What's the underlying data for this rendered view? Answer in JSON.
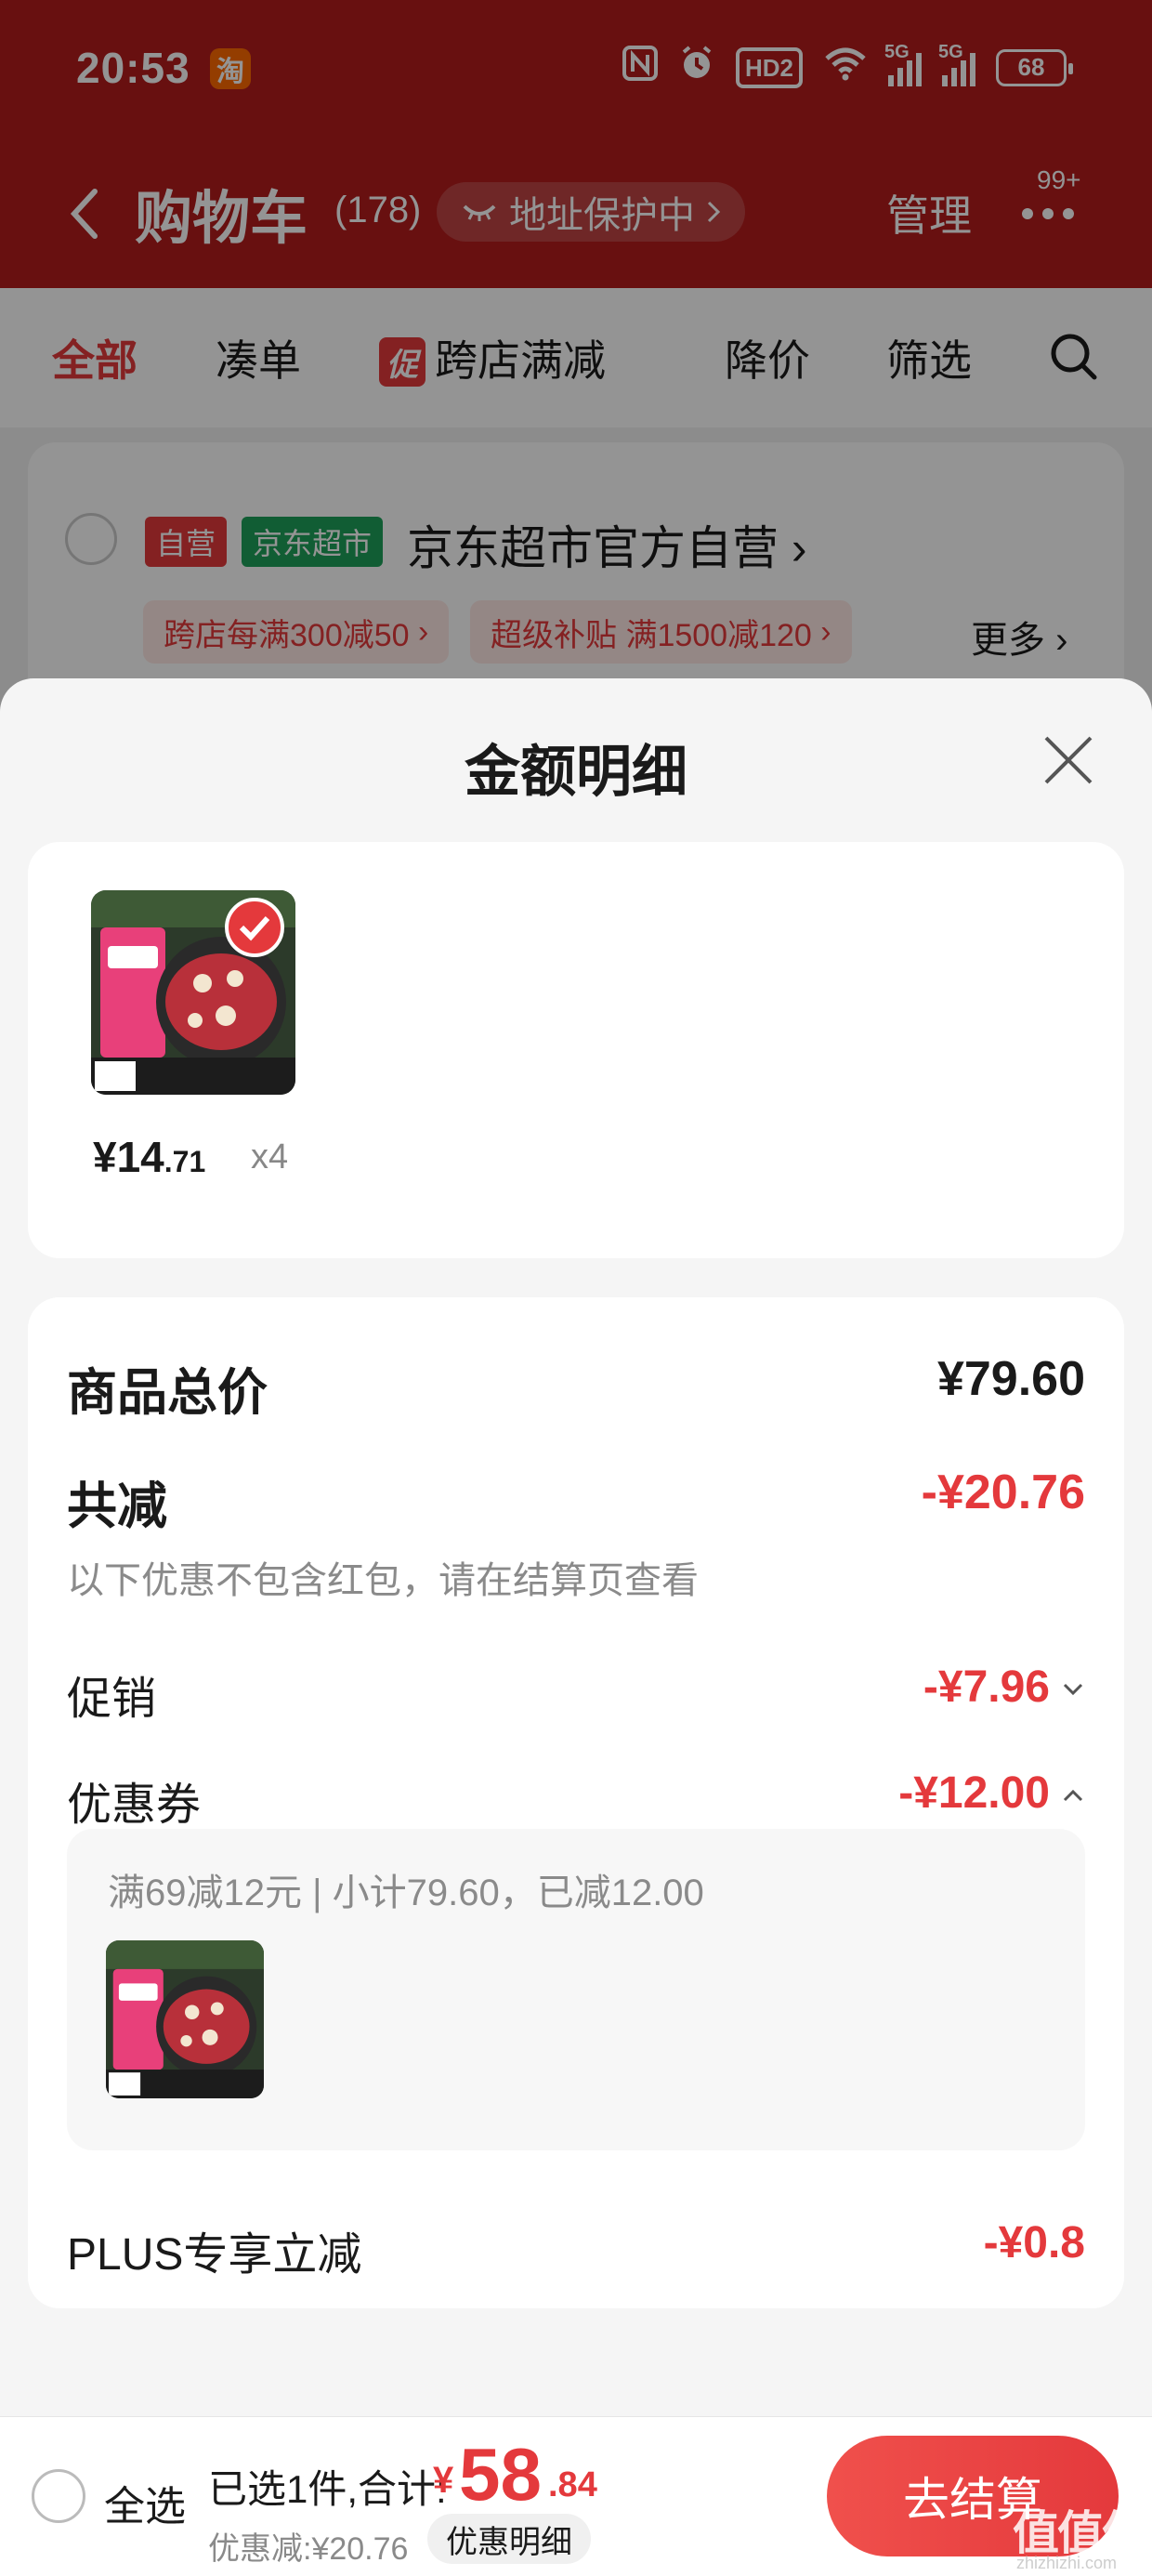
{
  "status_bar": {
    "time": "20:53",
    "app_badge": "淘",
    "hd_label": "HD2",
    "signal_1": "5G",
    "signal_2": "5G",
    "battery": "68"
  },
  "header": {
    "title": "购物车",
    "count": "(178)",
    "address_protect": "地址保护中",
    "manage": "管理",
    "message_badge": "99+"
  },
  "filters": {
    "all": "全部",
    "bundle": "凑单",
    "promo_badge": "促",
    "cross_store": "跨店满减",
    "price_drop": "降价",
    "filter": "筛选"
  },
  "store": {
    "tag_self": "自营",
    "tag_super": "京东超市",
    "name": "京东超市官方自营",
    "promo_1": "跨店每满300减50",
    "promo_2": "超级补贴 满1500减120",
    "more": "更多"
  },
  "sheet": {
    "title": "金额明细",
    "item": {
      "price_int": "¥14",
      "price_dec": ".71",
      "qty": "x4"
    },
    "summary": {
      "goods_total_label": "商品总价",
      "goods_total_value": "¥79.60",
      "total_discount_label": "共减",
      "total_discount_value": "-¥20.76",
      "hint": "以下优惠不包含红包，请在结算页查看",
      "promo_label": "促销",
      "promo_value": "-¥7.96",
      "coupon_label": "优惠券",
      "coupon_value": "-¥12.00",
      "coupon_detail": "满69减12元 | 小计79.60，已减12.00",
      "plus_label": "PLUS专享立减",
      "plus_value": "-¥0.8"
    }
  },
  "bottom_bar": {
    "select_all": "全选",
    "selected": "已选1件,合计:",
    "currency": "¥",
    "total_int": "58",
    "total_dec": ".84",
    "discount": "优惠减:¥20.76",
    "detail": "优惠明细",
    "checkout": "去结算"
  },
  "watermark": {
    "main": "值值值",
    "sub": "zhizhizhi.com"
  },
  "colors": {
    "header_red": "#b31c1c",
    "accent_red": "#e4393c",
    "green_tag": "#1ea05a"
  }
}
